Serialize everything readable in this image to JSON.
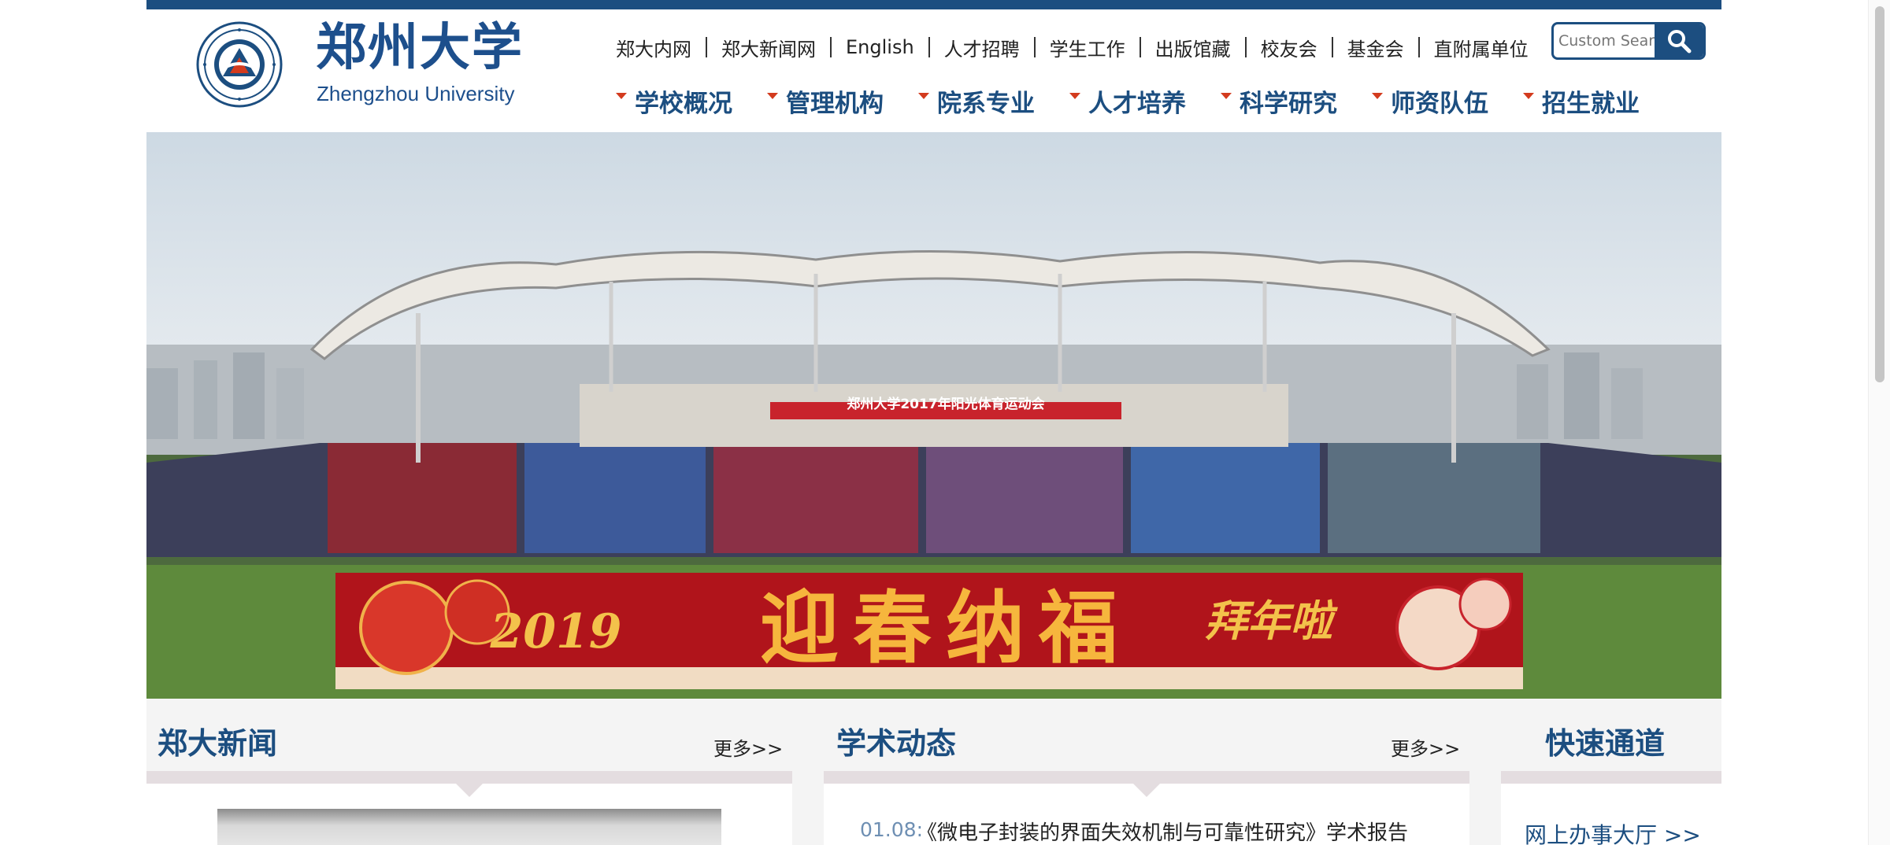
{
  "header": {
    "logo_title": "郑州大学",
    "logo_subtitle": "Zhengzhou University"
  },
  "util_nav": [
    "郑大内网",
    "郑大新闻网",
    "English",
    "人才招聘",
    "学生工作",
    "出版馆藏",
    "校友会",
    "基金会",
    "直附属单位"
  ],
  "search": {
    "placeholder": "Custom Search"
  },
  "main_nav": [
    "学校概况",
    "管理机构",
    "院系专业",
    "人才培养",
    "科学研究",
    "师资队伍",
    "招生就业"
  ],
  "banner": {
    "stadium_sign": "郑州大学2017年阳光体育运动会",
    "greeting": "迎春纳福",
    "year": "2019",
    "blessing": "拜年啦"
  },
  "sections": {
    "news": {
      "title": "郑大新闻",
      "more": "更多>>"
    },
    "academic": {
      "title": "学术动态",
      "more": "更多>>",
      "items": [
        {
          "date": "01.08:",
          "text": "《微电子封装的界面失效机制与可靠性研究》学术报告"
        }
      ]
    },
    "quick": {
      "title": "快速通道",
      "links": [
        "网上办事大厅 >>"
      ]
    }
  },
  "colors": {
    "brand_blue": "#1c4e80",
    "accent_red": "#d33b1e",
    "link_blue": "#6e8fb3"
  }
}
